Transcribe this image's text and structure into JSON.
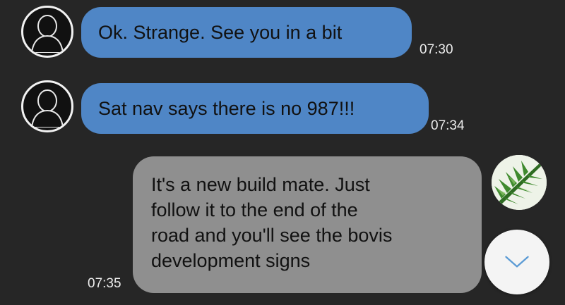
{
  "messages": [
    {
      "direction": "incoming",
      "text": "Ok. Strange. See you in a bit",
      "time": "07:30"
    },
    {
      "direction": "incoming",
      "text": "Sat nav says there is no 987!!!",
      "time": "07:34"
    },
    {
      "direction": "outgoing",
      "lines": [
        "It's a new build mate. Just",
        "follow it to the end of the",
        "road and you'll see the bovis",
        "development signs"
      ],
      "time": "07:35"
    }
  ],
  "colors": {
    "background": "#262626",
    "incoming_bubble": "#4f86c6",
    "outgoing_bubble": "#8f8f8f",
    "timestamp": "#ececec"
  },
  "icons": {
    "contact_avatar": "person-silhouette-icon",
    "own_avatar": "fern-leaf-icon",
    "scroll_button": "chevron-down-icon"
  }
}
